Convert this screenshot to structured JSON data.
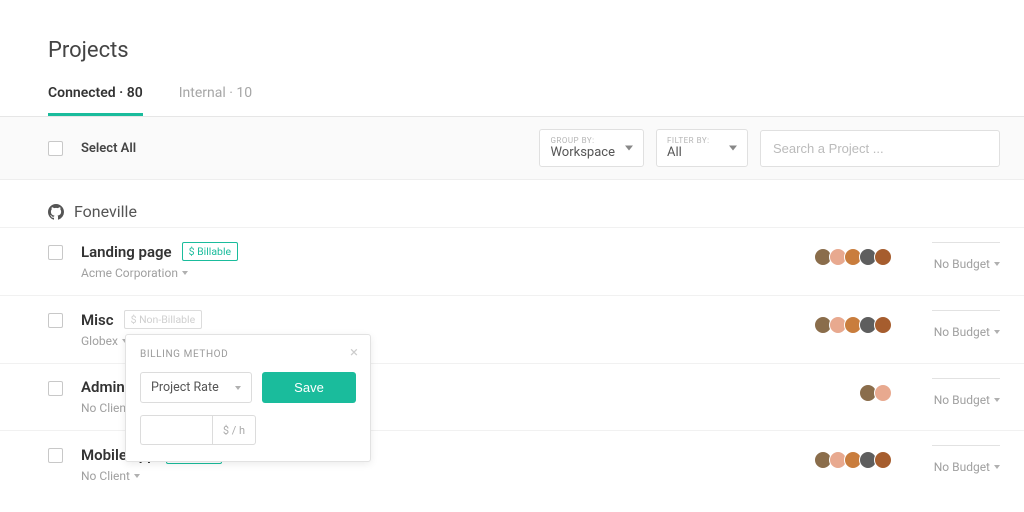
{
  "page_title": "Projects",
  "tabs": {
    "connected": {
      "label": "Connected",
      "count": "80"
    },
    "internal": {
      "label": "Internal",
      "count": "10"
    }
  },
  "filters": {
    "select_all": "Select All",
    "group_by_label": "GROUP BY:",
    "group_by_value": "Workspace",
    "filter_by_label": "FILTER BY:",
    "filter_by_value": "All",
    "search_placeholder": "Search a Project ..."
  },
  "group": {
    "name": "Foneville"
  },
  "badges": {
    "billable": "$ Billable",
    "non_billable": "$ Non-Billable"
  },
  "projects": [
    {
      "title": "Landing page",
      "client": "Acme Corporation",
      "budget": "No Budget",
      "avatars": 5
    },
    {
      "title": "Misc",
      "client": "Globex",
      "budget": "No Budget",
      "avatars": 5
    },
    {
      "title": "Admin",
      "client": "No Client",
      "budget": "No Budget",
      "avatars": 2
    },
    {
      "title": "Mobile app",
      "client": "No Client",
      "budget": "No Budget",
      "avatars": 5
    }
  ],
  "popover": {
    "title": "BILLING METHOD",
    "select_value": "Project Rate",
    "save": "Save",
    "rate_unit": "$ / h"
  }
}
